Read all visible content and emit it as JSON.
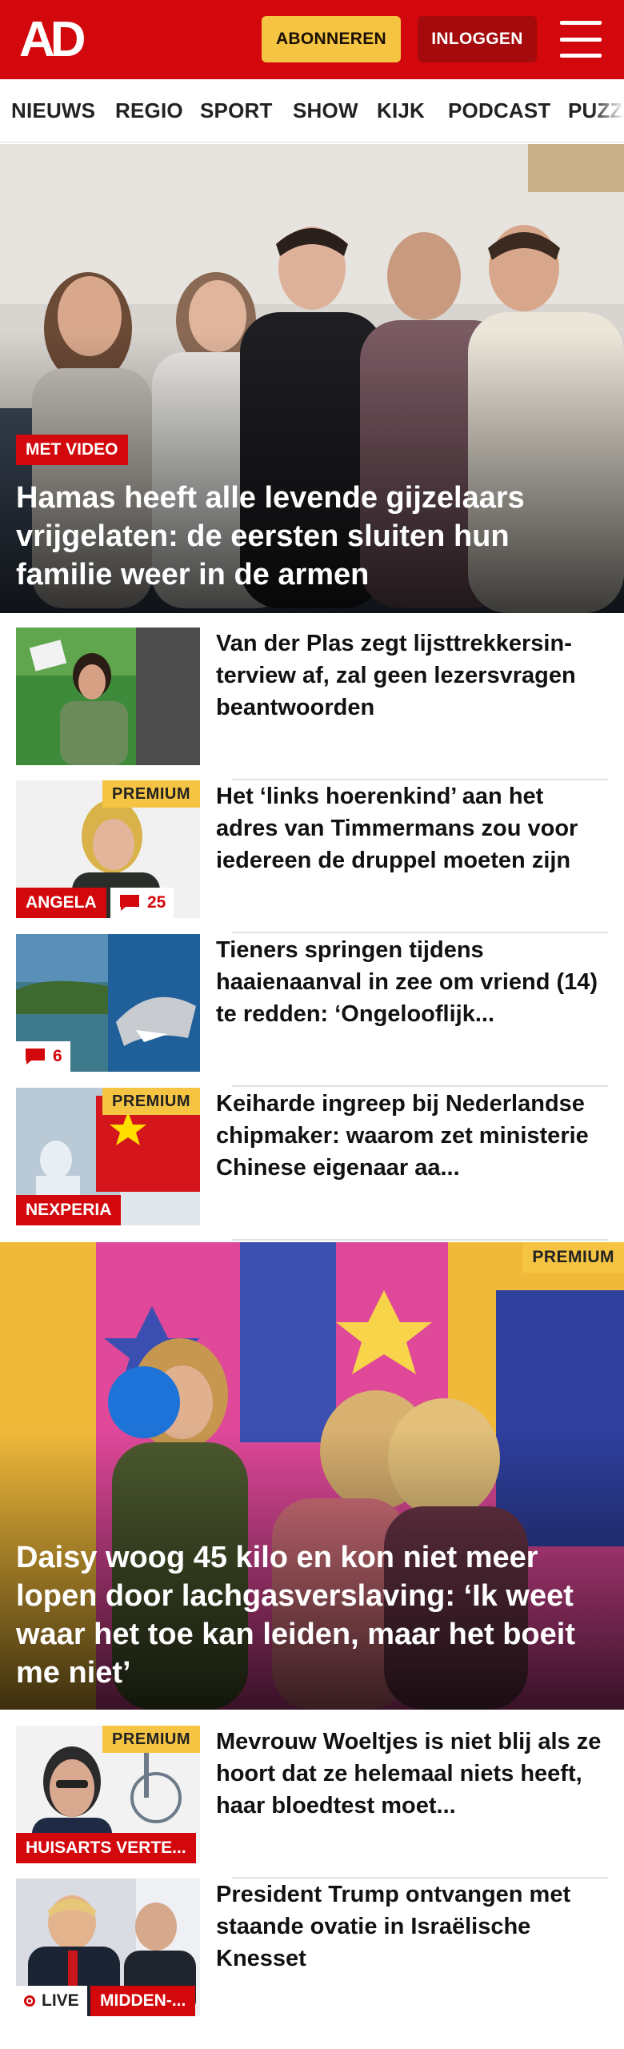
{
  "header": {
    "logo_text": "AD",
    "subscribe_label": "ABONNEREN",
    "login_label": "INLOGGEN",
    "menu_icon": "hamburger-menu-icon"
  },
  "nav": {
    "items": [
      "NIEUWS",
      "REGIO",
      "SPORT",
      "SHOW",
      "KIJK",
      "PODCAST",
      "PUZZ"
    ]
  },
  "hero": {
    "label": "MET VIDEO",
    "title": "Hamas heeft alle levende gijzelaars vrijgelaten: de eersten sluiten hun familie weer in de armen"
  },
  "articles": [
    {
      "title": "Van der Plas zegt lijsttrekkersin-terview af, zal geen lezersvragen beantwoorden"
    },
    {
      "title": "Het ‘links hoerenkind’ aan het adres van Timmermans zou voor iedereen de druppel moeten zijn",
      "premium": "PREMIUM",
      "tag": "ANGELA",
      "comments": "25"
    },
    {
      "title": "Tieners springen tijdens haaienaanval in zee om vriend (14) te redden: ‘Ongelooflijk...",
      "comments": "6"
    },
    {
      "title": "Keiharde ingreep bij Nederlandse chipmaker: waarom zet ministerie Chinese eigenaar aa...",
      "premium": "PREMIUM",
      "tag": "NEXPERIA"
    }
  ],
  "hero2": {
    "premium": "PREMIUM",
    "title": "Daisy woog 45 kilo en kon niet meer lopen door lachgasverslaving: ‘Ik weet waar het toe kan leiden, maar het boeit me niet’"
  },
  "articles2": [
    {
      "title": "Mevrouw Woeltjes is niet blij als ze hoort dat ze helemaal niets heeft, haar bloedtest moet...",
      "premium": "PREMIUM",
      "tag": "HUISARTS VERTE..."
    },
    {
      "title": "President Trump ontvangen met staande ovatie in Israëlische Knesset",
      "live": "LIVE",
      "tag": "MIDDEN-..."
    }
  ]
}
